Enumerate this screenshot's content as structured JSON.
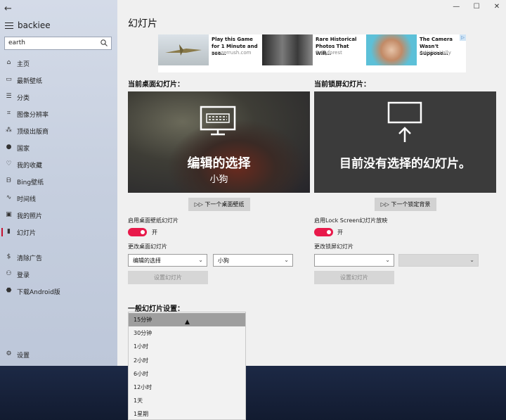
{
  "app": {
    "name": "backiee",
    "back_glyph": "←"
  },
  "search": {
    "value": "earth"
  },
  "sidebar": {
    "items": [
      {
        "label": "主页",
        "icon": "home-icon",
        "glyph": "⌂"
      },
      {
        "label": "最新壁纸",
        "icon": "image-icon",
        "glyph": "▭"
      },
      {
        "label": "分类",
        "icon": "list-icon",
        "glyph": "☰"
      },
      {
        "label": "图像分辨率",
        "icon": "crop-icon",
        "glyph": "⌗"
      },
      {
        "label": "顶级出版商",
        "icon": "publisher-icon",
        "glyph": "⁂"
      },
      {
        "label": "国家",
        "icon": "globe-icon",
        "glyph": "●"
      },
      {
        "label": "我的收藏",
        "icon": "heart-icon",
        "glyph": "♡"
      },
      {
        "label": "Bing壁纸",
        "icon": "bing-icon",
        "glyph": "ᗷ"
      },
      {
        "label": "时间线",
        "icon": "timeline-icon",
        "glyph": "∿"
      },
      {
        "label": "我的照片",
        "icon": "photo-icon",
        "glyph": "▣"
      },
      {
        "label": "幻灯片",
        "icon": "slideshow-icon",
        "glyph": "▮"
      },
      {
        "label": "清除广告",
        "icon": "dollar-icon",
        "glyph": "$"
      },
      {
        "label": "登录",
        "icon": "user-icon",
        "glyph": "⚇"
      },
      {
        "label": "下载Android版",
        "icon": "android-icon",
        "glyph": "⬣"
      }
    ],
    "settings": {
      "label": "设置",
      "icon": "gear-icon",
      "glyph": "⚙"
    }
  },
  "window_controls": {
    "minimize": "—",
    "maximize": "☐",
    "close": "✕"
  },
  "page": {
    "title": "幻灯片"
  },
  "ads": [
    {
      "title": "Play this Game for 1 Minute and see…",
      "source": "panzerrush.com"
    },
    {
      "title": "Rare Historical Photos That Will…",
      "source": "Dailyforest"
    },
    {
      "title": "The Camera Wasn't Suppose…",
      "source": "Articles Vally"
    }
  ],
  "ad_badge": "▷",
  "desktop_section": {
    "heading": "当前桌面幻灯片：",
    "preview_title": "编辑的选择",
    "preview_subtitle": "小狗",
    "next_button": "下一个桌面壁纸",
    "next_glyph": "▷▷",
    "toggle_label": "启用桌面壁纸幻灯片",
    "toggle_state": "开",
    "change_label": "更改桌面幻灯片",
    "select1": "编辑的选择",
    "select2": "小狗",
    "chevron": "⌄",
    "set_button": "设置幻灯片"
  },
  "lock_section": {
    "heading": "当前锁屏幻灯片：",
    "preview_title": "目前没有选择的幻灯片。",
    "next_button": "下一个锁定背景",
    "next_glyph": "▷▷",
    "toggle_label": "启用Lock Screen幻灯片放映",
    "toggle_state": "开",
    "change_label": "更改锁屏幻灯片",
    "select1": "",
    "select2": "",
    "chevron": "⌄",
    "set_button": "设置幻灯片"
  },
  "general": {
    "heading": "一般幻灯片设置：",
    "interval_options": [
      "15分钟",
      "30分钟",
      "1小时",
      "2小时",
      "6小时",
      "12小时",
      "1天",
      "1星期"
    ],
    "selected_index": 0
  }
}
